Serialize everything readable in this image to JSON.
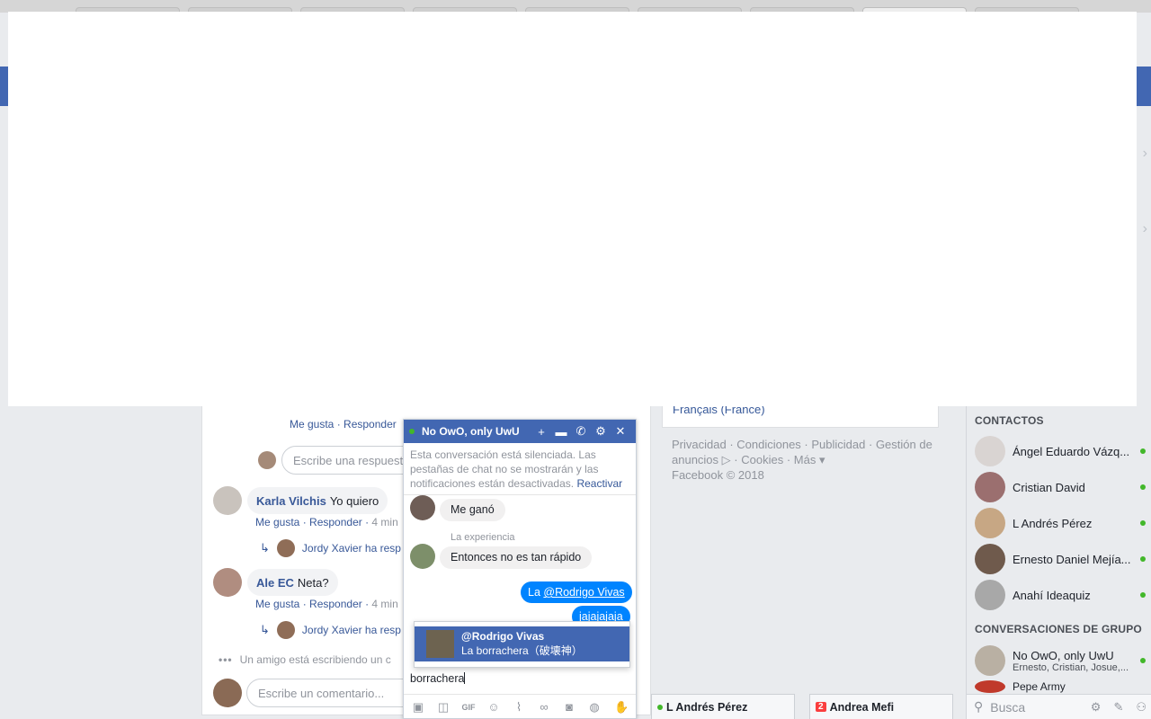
{
  "feed": {
    "top_actions": {
      "like": "Me gusta",
      "reply": "Responder"
    },
    "reply_placeholder": "Escribe una respuest",
    "comments": [
      {
        "author": "Karla Vilchis",
        "text": "Yo quiero",
        "like": "Me gusta",
        "reply": "Responder",
        "time": "4 min",
        "reply_summary": "Jordy Xavier ha resp"
      },
      {
        "author": "Ale EC",
        "text": "Neta?",
        "like": "Me gusta",
        "reply": "Responder",
        "time": "4 min",
        "reply_summary": "Jordy Xavier ha resp"
      }
    ],
    "typing": "Un amigo está escribiendo un c",
    "comment_placeholder": "Escribe un comentario..."
  },
  "middle": {
    "language": "Français (France)",
    "footer": [
      "Privacidad",
      "Condiciones",
      "Publicidad",
      "Gestión de anuncios",
      "Cookies",
      "Más",
      "Facebook © 2018"
    ]
  },
  "chat": {
    "title": "No OwO, only UwU",
    "muted_note": "Esta conversación está silenciada. Las pestañas de chat no se mostrarán y las notificaciones están desactivadas.",
    "reactivate": "Reactivar",
    "messages": {
      "partial": "Me ganó",
      "sender_label": "La experiencia",
      "in_text": "Entonces no es tan rápido",
      "out_prefix": "La ",
      "out_mention": "@Rodrigo Vivas",
      "out_second": "jajajajaja"
    },
    "mention": {
      "name": "@Rodrigo Vivas",
      "sub": "La borrachera（破壊神）"
    },
    "composer_text": "borrachera"
  },
  "tabs": [
    {
      "label": "L Andrés Pérez"
    },
    {
      "label": "Andrea Mefi",
      "badge": "2"
    }
  ],
  "sidebar": {
    "contacts_heading": "CONTACTOS",
    "contacts": [
      {
        "name": "Ángel Eduardo Vázq..."
      },
      {
        "name": "Cristian David"
      },
      {
        "name": "L Andrés Pérez"
      },
      {
        "name": "Ernesto Daniel Mejía..."
      },
      {
        "name": "Anahí Ideaquiz"
      }
    ],
    "groups_heading": "CONVERSACIONES DE GRUPO",
    "groups": [
      {
        "name": "No OwO, only UwU",
        "members": "Ernesto, Cristian, Josue,..."
      },
      {
        "name": "Pepe Army"
      }
    ],
    "search_placeholder": "Busca"
  },
  "colors": {
    "brand": "#4267b2",
    "online": "#42b72a",
    "messenger_blue": "#0084ff"
  }
}
